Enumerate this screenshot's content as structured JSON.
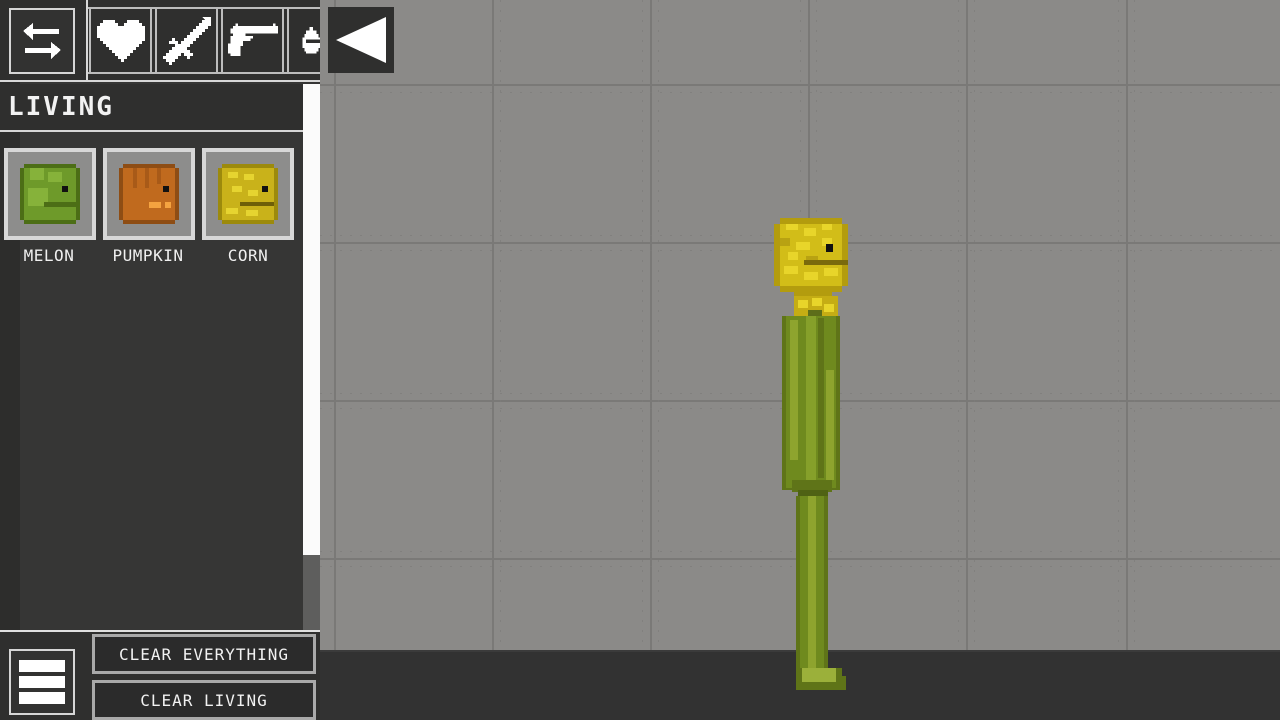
{
  "toolbar": {
    "swap_button": {
      "icon": "swap-arrows-icon"
    },
    "category_tabs": [
      {
        "icon": "heart-icon",
        "name": "living",
        "selected": true
      },
      {
        "icon": "sword-icon",
        "name": "melee"
      },
      {
        "icon": "gun-icon",
        "name": "firearms"
      },
      {
        "icon": "explosive-icon",
        "name": "explosives",
        "partially_visible": true
      }
    ],
    "collapse_button": {
      "icon": "collapse-triangle-icon"
    }
  },
  "category": {
    "title": "LIVING"
  },
  "items": [
    {
      "label": "MELON",
      "icon": "melon-head-icon",
      "color": "#6e9a2a"
    },
    {
      "label": "PUMPKIN",
      "icon": "pumpkin-head-icon",
      "color": "#c06a1e"
    },
    {
      "label": "CORN",
      "icon": "corn-head-icon",
      "color": "#c9b21a"
    }
  ],
  "scrollbar": {
    "thumb_fraction": 0.86,
    "position": 0
  },
  "bottom": {
    "menu_icon": "hamburger-menu-icon",
    "clear_everything_label": "CLEAR EVERYTHING",
    "clear_living_label": "CLEAR LIVING"
  },
  "world": {
    "entities": [
      {
        "type": "corn-person",
        "state": "standing"
      }
    ],
    "colors": {
      "background": "#8b8a88",
      "ground": "#323232",
      "corn_yellow": "#d4c016",
      "body_green": "#6f8a1e"
    }
  }
}
